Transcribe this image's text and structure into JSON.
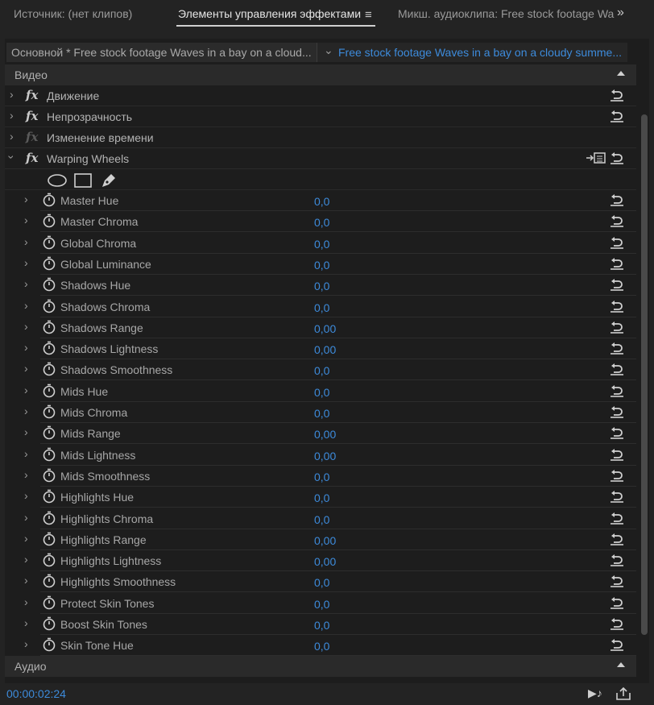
{
  "tabs": [
    {
      "label": "Источник: (нет клипов)"
    },
    {
      "label": "Элементы управления эффектами"
    },
    {
      "label": "Микш. аудиоклипа: Free stock footage Wa"
    }
  ],
  "clip_bar": {
    "master": "Основной * Free stock footage Waves in a bay on a cloud...",
    "sequence": "Free stock footage Waves in a bay on a cloudy summe..."
  },
  "sections": {
    "video": "Видео",
    "audio": "Аудио"
  },
  "effects": [
    {
      "name": "Движение",
      "enabled": true
    },
    {
      "name": "Непрозрачность",
      "enabled": true
    },
    {
      "name": "Изменение времени",
      "enabled": false
    },
    {
      "name": "Warping Wheels",
      "enabled": true
    }
  ],
  "params": [
    {
      "name": "Master Hue",
      "value": "0,0"
    },
    {
      "name": "Master Chroma",
      "value": "0,0"
    },
    {
      "name": "Global Chroma",
      "value": "0,0"
    },
    {
      "name": "Global Luminance",
      "value": "0,0"
    },
    {
      "name": "Shadows Hue",
      "value": "0,0"
    },
    {
      "name": "Shadows Chroma",
      "value": "0,0"
    },
    {
      "name": "Shadows Range",
      "value": "0,00"
    },
    {
      "name": "Shadows Lightness",
      "value": "0,00"
    },
    {
      "name": "Shadows Smoothness",
      "value": "0,0"
    },
    {
      "name": "Mids Hue",
      "value": "0,0"
    },
    {
      "name": "Mids Chroma",
      "value": "0,0"
    },
    {
      "name": "Mids Range",
      "value": "0,00"
    },
    {
      "name": "Mids Lightness",
      "value": "0,00"
    },
    {
      "name": "Mids Smoothness",
      "value": "0,0"
    },
    {
      "name": "Highlights Hue",
      "value": "0,0"
    },
    {
      "name": "Highlights Chroma",
      "value": "0,0"
    },
    {
      "name": "Highlights Range",
      "value": "0,00"
    },
    {
      "name": "Highlights Lightness",
      "value": "0,00"
    },
    {
      "name": "Highlights Smoothness",
      "value": "0,0"
    },
    {
      "name": "Protect Skin Tones",
      "value": "0,0"
    },
    {
      "name": "Boost Skin Tones",
      "value": "0,0"
    },
    {
      "name": "Skin Tone Hue",
      "value": "0,0"
    }
  ],
  "footer": {
    "timecode": "00:00:02:24"
  },
  "colors": {
    "accent": "#3d8bdb",
    "background": "#1d1d1d"
  }
}
